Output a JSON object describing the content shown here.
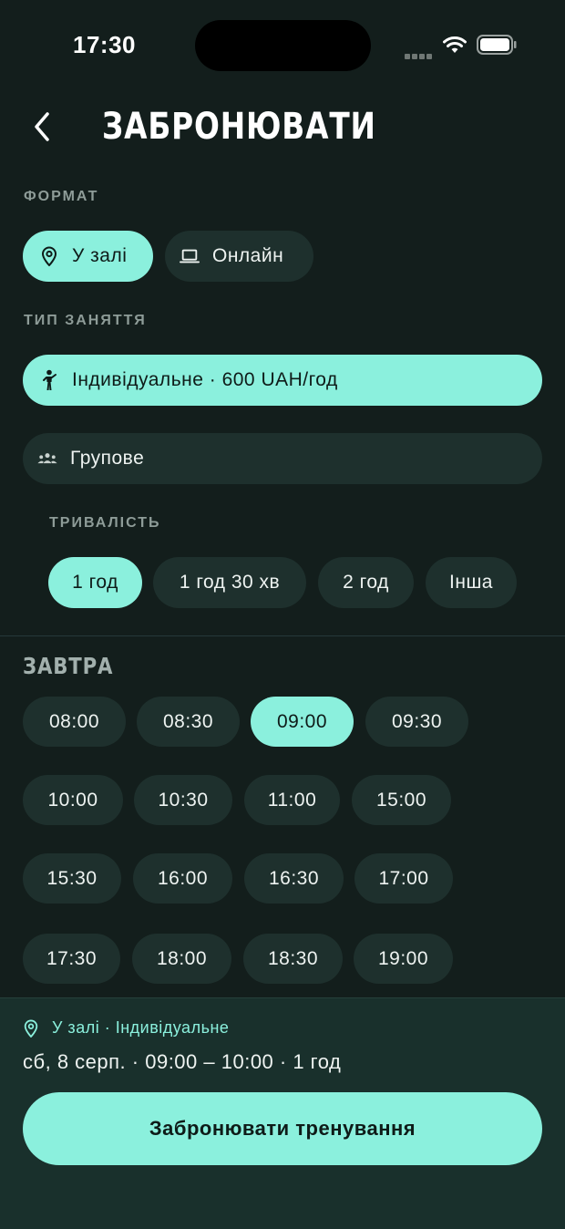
{
  "status": {
    "time": "17:30"
  },
  "header": {
    "title": "ЗАБРОНЮВАТИ"
  },
  "format": {
    "label": "ФОРМАТ",
    "options": [
      {
        "label": "У залі",
        "icon": "location-pin-icon",
        "selected": true
      },
      {
        "label": "Онлайн",
        "icon": "laptop-icon",
        "selected": false
      }
    ]
  },
  "session_type": {
    "label": "ТИП ЗАНЯТТЯ",
    "options": [
      {
        "label": "Індивідуальне · 600 UAH/год",
        "icon": "person-icon",
        "selected": true
      },
      {
        "label": "Групове",
        "icon": "group-icon",
        "selected": false
      }
    ]
  },
  "duration": {
    "label": "ТРИВАЛІСТЬ",
    "options": [
      "1 год",
      "1 год 30 хв",
      "2 год",
      "Інша"
    ],
    "selected": "1 год"
  },
  "schedule": {
    "day": "ЗАВТРА",
    "slots": [
      "08:00",
      "08:30",
      "09:00",
      "09:30",
      "10:00",
      "10:30",
      "11:00",
      "15:00",
      "15:30",
      "16:00",
      "16:30",
      "17:00",
      "17:30",
      "18:00",
      "18:30",
      "19:00"
    ],
    "selected": "09:00"
  },
  "summary": {
    "tag": "У залі · Індивідуальне",
    "datetime": "сб, 8 серп. · 09:00 – 10:00 · 1 год",
    "button": "Забронювати тренування"
  },
  "colors": {
    "background": "#131e1c",
    "accent": "#8bf0dd",
    "pill": "#1e302d",
    "summary_bg": "#19302c"
  }
}
